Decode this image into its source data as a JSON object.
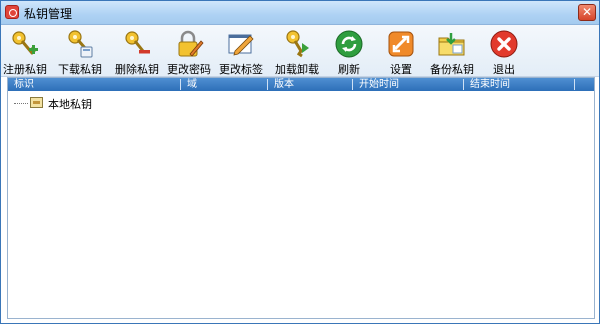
{
  "window": {
    "title": "私钥管理",
    "close_label": "✕"
  },
  "toolbar": {
    "items": [
      {
        "label": "注册私钥",
        "icon": "key-add-icon"
      },
      {
        "label": "下载私钥",
        "icon": "key-download-icon"
      },
      {
        "label": "删除私钥",
        "icon": "key-delete-icon"
      },
      {
        "label": "更改密码",
        "icon": "lock-edit-icon"
      },
      {
        "label": "更改标签",
        "icon": "pencil-edit-icon"
      },
      {
        "label": "加载卸载",
        "icon": "key-load-icon"
      },
      {
        "label": "刷新",
        "icon": "refresh-icon"
      },
      {
        "label": "设置",
        "icon": "settings-icon"
      },
      {
        "label": "备份私钥",
        "icon": "folder-backup-icon"
      },
      {
        "label": "退出",
        "icon": "exit-icon"
      }
    ]
  },
  "table": {
    "columns": [
      "标识",
      "域",
      "版本",
      "开始时间",
      "结束时间"
    ],
    "tree": {
      "label": "本地私钥"
    }
  },
  "colors": {
    "accent": "#2d6fb8",
    "title_bar": "#aed2f4",
    "close": "#d6452b"
  }
}
